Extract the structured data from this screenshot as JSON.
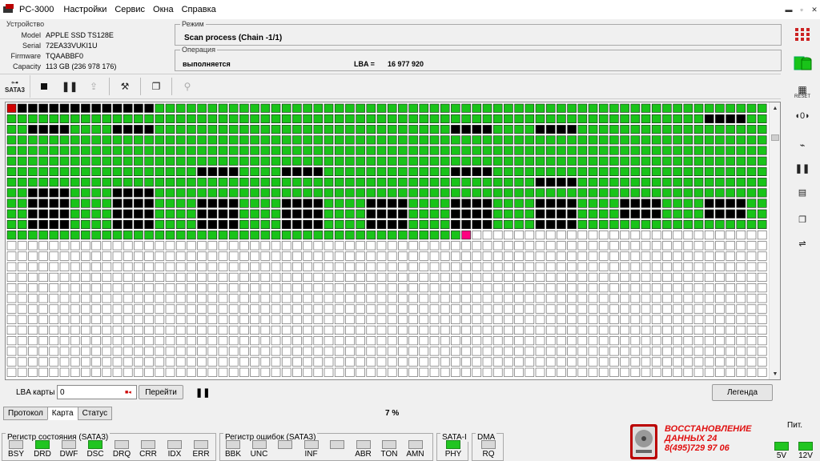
{
  "app": {
    "title": "PC-3000",
    "menu": [
      "Настройки",
      "Сервис",
      "Окна",
      "Справка"
    ]
  },
  "device": {
    "group_title": "Устройство",
    "model_label": "Model",
    "model": "APPLE SSD TS128E",
    "serial_label": "Serial",
    "serial": "72EA33VUKI1U",
    "firmware_label": "Firmware",
    "firmware": "TQAABBF0",
    "capacity_label": "Capacity",
    "capacity": "113 GB (236 978 176)"
  },
  "mode": {
    "group_title": "Режим",
    "value": "Scan process (Chain -1/1)"
  },
  "operation": {
    "group_title": "Операция",
    "status": "выполняется",
    "lba_label": "LBA =",
    "lba_value": "16 977 920"
  },
  "toolbar": {
    "interface_label": "SATA3"
  },
  "map": {
    "cols": 72,
    "rows": 26,
    "filled_rows": 12,
    "current_block": {
      "row": 12,
      "col": 43
    },
    "colors": {
      "good": "#19c319",
      "bad": "#000000",
      "empty": "#ffffff",
      "current": "#ff0080",
      "first": "#d00000"
    }
  },
  "controls": {
    "lba_map_label": "LBA карты",
    "lba_map_value": "0",
    "goto_button": "Перейти",
    "legend_button": "Легенда",
    "progress": "7 %"
  },
  "tabs": [
    "Протокол",
    "Карта",
    "Статус"
  ],
  "status_register": {
    "title": "Регистр состояния (SATA3)",
    "leds": [
      {
        "label": "BSY",
        "on": false
      },
      {
        "label": "DRD",
        "on": true
      },
      {
        "label": "DWF",
        "on": false
      },
      {
        "label": "DSC",
        "on": true
      },
      {
        "label": "DRQ",
        "on": false
      },
      {
        "label": "CRR",
        "on": false
      },
      {
        "label": "IDX",
        "on": false
      },
      {
        "label": "ERR",
        "on": false
      }
    ]
  },
  "error_register": {
    "title": "Регистр ошибок  (SATA3)",
    "leds": [
      {
        "label": "BBK",
        "on": false
      },
      {
        "label": "UNC",
        "on": false
      },
      {
        "label": "",
        "on": false
      },
      {
        "label": "INF",
        "on": false
      },
      {
        "label": "",
        "on": false
      },
      {
        "label": "ABR",
        "on": false
      },
      {
        "label": "TON",
        "on": false
      },
      {
        "label": "AMN",
        "on": false
      }
    ]
  },
  "sata_register": {
    "title": "SATA-I",
    "leds": [
      {
        "label": "PHY",
        "on": true
      }
    ]
  },
  "dma_register": {
    "title": "DMA",
    "leds": [
      {
        "label": "RQ",
        "on": false
      }
    ]
  },
  "power": {
    "title": "Пит.",
    "leds": [
      {
        "label": "5V",
        "on": true
      },
      {
        "label": "12V",
        "on": true
      }
    ]
  },
  "promo": {
    "line1": "ВОССТАНОВЛЕНИЕ",
    "line2": "ДАННЫХ  24",
    "line3": "8(495)729 97 06"
  },
  "icons": {
    "stop": "stop-icon",
    "pause": "pause-icon",
    "export": "export-icon",
    "tools": "tools-icon",
    "windows": "windows-icon",
    "run": "run-icon"
  }
}
